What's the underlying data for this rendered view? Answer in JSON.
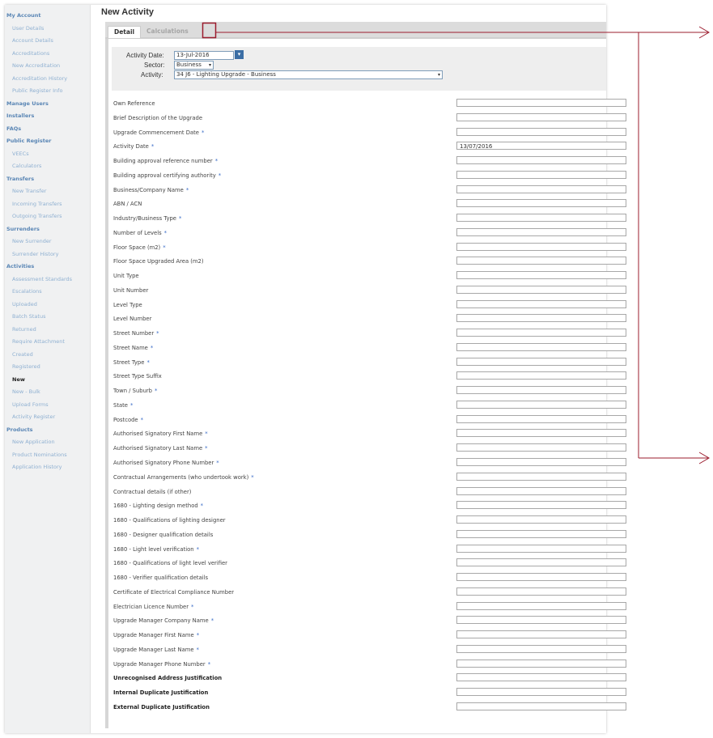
{
  "page": {
    "title": "New Activity"
  },
  "sidebar": [
    {
      "label": "My Account",
      "kind": "sec"
    },
    {
      "label": "User Details",
      "kind": "sub"
    },
    {
      "label": "Account Details",
      "kind": "sub"
    },
    {
      "label": "Accreditations",
      "kind": "sub"
    },
    {
      "label": "New Accreditation",
      "kind": "sub"
    },
    {
      "label": "Accreditation History",
      "kind": "sub"
    },
    {
      "label": "Public Register Info",
      "kind": "sub"
    },
    {
      "label": "Manage Users",
      "kind": "sec"
    },
    {
      "label": "Installers",
      "kind": "sec"
    },
    {
      "label": "FAQs",
      "kind": "sec"
    },
    {
      "label": "Public Register",
      "kind": "sec"
    },
    {
      "label": "VEECs",
      "kind": "sub"
    },
    {
      "label": "Calculators",
      "kind": "sub"
    },
    {
      "label": "Transfers",
      "kind": "sec"
    },
    {
      "label": "New Transfer",
      "kind": "sub"
    },
    {
      "label": "Incoming Transfers",
      "kind": "sub"
    },
    {
      "label": "Outgoing Transfers",
      "kind": "sub"
    },
    {
      "label": "Surrenders",
      "kind": "sec"
    },
    {
      "label": "New Surrender",
      "kind": "sub"
    },
    {
      "label": "Surrender History",
      "kind": "sub"
    },
    {
      "label": "Activities",
      "kind": "sec"
    },
    {
      "label": "Assessment Standards",
      "kind": "sub"
    },
    {
      "label": "Escalations",
      "kind": "sub"
    },
    {
      "label": "Uploaded",
      "kind": "sub"
    },
    {
      "label": "Batch Status",
      "kind": "sub"
    },
    {
      "label": "Returned",
      "kind": "sub"
    },
    {
      "label": "Require Attachment",
      "kind": "sub"
    },
    {
      "label": "Created",
      "kind": "sub"
    },
    {
      "label": "Registered",
      "kind": "sub"
    },
    {
      "label": "New",
      "kind": "active"
    },
    {
      "label": "New - Bulk",
      "kind": "sub"
    },
    {
      "label": "Upload Forms",
      "kind": "sub"
    },
    {
      "label": "Activity Register",
      "kind": "sub"
    },
    {
      "label": "Products",
      "kind": "sec"
    },
    {
      "label": "New Application",
      "kind": "sub"
    },
    {
      "label": "Product Nominations",
      "kind": "sub"
    },
    {
      "label": "Application History",
      "kind": "sub"
    }
  ],
  "tabs": {
    "detail": "Detail",
    "calculations": "Calculations"
  },
  "top": {
    "activity_date_label": "Activity Date:",
    "activity_date_value": "13-Jul-2016",
    "sector_label": "Sector:",
    "sector_value": "Business",
    "activity_label": "Activity:",
    "activity_value": "34 J6 - Lighting Upgrade - Business"
  },
  "fields": [
    {
      "label": "Own Reference",
      "required": false,
      "bold": false,
      "value": ""
    },
    {
      "label": "Brief Description of the Upgrade",
      "required": false,
      "bold": false,
      "value": ""
    },
    {
      "label": "Upgrade Commencement Date",
      "required": true,
      "bold": false,
      "value": ""
    },
    {
      "label": "Activity Date",
      "required": true,
      "bold": false,
      "value": "13/07/2016"
    },
    {
      "label": "Building approval reference number",
      "required": true,
      "bold": false,
      "value": ""
    },
    {
      "label": "Building approval certifying authority",
      "required": true,
      "bold": false,
      "value": ""
    },
    {
      "label": "Business/Company Name",
      "required": true,
      "bold": false,
      "value": ""
    },
    {
      "label": "ABN / ACN",
      "required": false,
      "bold": false,
      "value": ""
    },
    {
      "label": "Industry/Business Type",
      "required": true,
      "bold": false,
      "value": ""
    },
    {
      "label": "Number of Levels",
      "required": true,
      "bold": false,
      "value": ""
    },
    {
      "label": "Floor Space (m2)",
      "required": true,
      "bold": false,
      "value": ""
    },
    {
      "label": "Floor Space Upgraded Area (m2)",
      "required": false,
      "bold": false,
      "value": ""
    },
    {
      "label": "Unit Type",
      "required": false,
      "bold": false,
      "value": ""
    },
    {
      "label": "Unit Number",
      "required": false,
      "bold": false,
      "value": ""
    },
    {
      "label": "Level Type",
      "required": false,
      "bold": false,
      "value": ""
    },
    {
      "label": "Level Number",
      "required": false,
      "bold": false,
      "value": ""
    },
    {
      "label": "Street Number",
      "required": true,
      "bold": false,
      "value": ""
    },
    {
      "label": "Street Name",
      "required": true,
      "bold": false,
      "value": ""
    },
    {
      "label": "Street Type",
      "required": true,
      "bold": false,
      "value": ""
    },
    {
      "label": "Street Type Suffix",
      "required": false,
      "bold": false,
      "value": ""
    },
    {
      "label": "Town / Suburb",
      "required": true,
      "bold": false,
      "value": ""
    },
    {
      "label": "State",
      "required": true,
      "bold": false,
      "value": ""
    },
    {
      "label": "Postcode",
      "required": true,
      "bold": false,
      "value": ""
    },
    {
      "label": "Authorised Signatory First Name",
      "required": true,
      "bold": false,
      "value": ""
    },
    {
      "label": "Authorised Signatory Last Name",
      "required": true,
      "bold": false,
      "value": ""
    },
    {
      "label": "Authorised Signatory Phone Number",
      "required": true,
      "bold": false,
      "value": ""
    },
    {
      "label": "Contractual Arrangements (who undertook work)",
      "required": true,
      "bold": false,
      "value": ""
    },
    {
      "label": "Contractual details (if other)",
      "required": false,
      "bold": false,
      "value": ""
    },
    {
      "label": "1680 - Lighting design method",
      "required": true,
      "bold": false,
      "value": ""
    },
    {
      "label": "1680 - Qualifications of lighting designer",
      "required": false,
      "bold": false,
      "value": ""
    },
    {
      "label": "1680 - Designer qualification details",
      "required": false,
      "bold": false,
      "value": ""
    },
    {
      "label": "1680 - Light level verification",
      "required": true,
      "bold": false,
      "value": ""
    },
    {
      "label": "1680 - Qualifications of light level verifier",
      "required": false,
      "bold": false,
      "value": ""
    },
    {
      "label": "1680 - Verifier qualification details",
      "required": false,
      "bold": false,
      "value": ""
    },
    {
      "label": "Certificate of Electrical Compliance Number",
      "required": false,
      "bold": false,
      "value": ""
    },
    {
      "label": "Electrician Licence Number",
      "required": true,
      "bold": false,
      "value": ""
    },
    {
      "label": "Upgrade Manager Company Name",
      "required": true,
      "bold": false,
      "value": ""
    },
    {
      "label": "Upgrade Manager First Name",
      "required": true,
      "bold": false,
      "value": ""
    },
    {
      "label": "Upgrade Manager Last Name",
      "required": true,
      "bold": false,
      "value": ""
    },
    {
      "label": "Upgrade Manager Phone Number",
      "required": true,
      "bold": false,
      "value": ""
    },
    {
      "label": "Unrecognised Address Justification",
      "required": false,
      "bold": true,
      "value": ""
    },
    {
      "label": "Internal Duplicate Justification",
      "required": false,
      "bold": true,
      "value": ""
    },
    {
      "label": "External Duplicate Justification",
      "required": false,
      "bold": true,
      "value": ""
    }
  ],
  "required_marker": "*",
  "colors": {
    "annotation": "#9b1c2e",
    "link": "#8fb0d1",
    "section": "#5a86b5"
  }
}
